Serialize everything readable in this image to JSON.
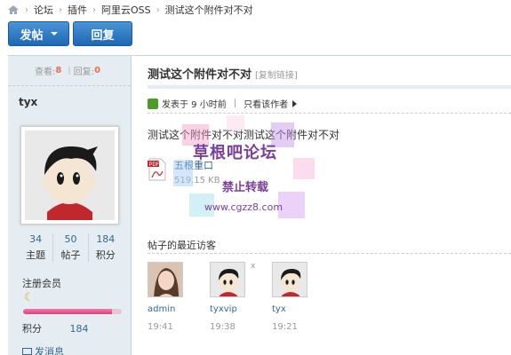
{
  "breadcrumb": {
    "items": [
      "论坛",
      "插件",
      "阿里云OSS",
      "测试这个附件对不对"
    ]
  },
  "toolbar": {
    "post_label": "发帖",
    "reply_label": "回复"
  },
  "author": {
    "views_label": "查看:",
    "views": "8",
    "replies_label": "回复:",
    "replies": "0",
    "name": "tyx",
    "counts": [
      {
        "num": "34",
        "label": "主题"
      },
      {
        "num": "50",
        "label": "帖子"
      },
      {
        "num": "184",
        "label": "积分"
      }
    ],
    "group": "注册会员",
    "credit_progress": 0.9,
    "credit_label": "积分",
    "credit_value": "184",
    "message_label": "发消息"
  },
  "post": {
    "title": "测试这个附件对不对",
    "copy_link": "[复制链接]",
    "posted": "发表于 9 小时前",
    "only_author": "只看该作者",
    "content": "测试这个附件对不对测试这个附件对不对",
    "attachment": {
      "name": "五根重口",
      "size": "519.15 KB"
    }
  },
  "visitors": {
    "title": "帖子的最近访客",
    "list": [
      {
        "name": "admin",
        "time": "19:41"
      },
      {
        "name": "tyxvip",
        "time": "19:38"
      },
      {
        "name": "tyx",
        "time": "19:21"
      }
    ]
  },
  "watermark": {
    "line1": "草根吧论坛",
    "line2": "禁止转载",
    "line3": "www.cgzz8.com"
  },
  "colors": {
    "accent": "#1d67b4",
    "link": "#336699",
    "highlight": "#f26c4f"
  }
}
